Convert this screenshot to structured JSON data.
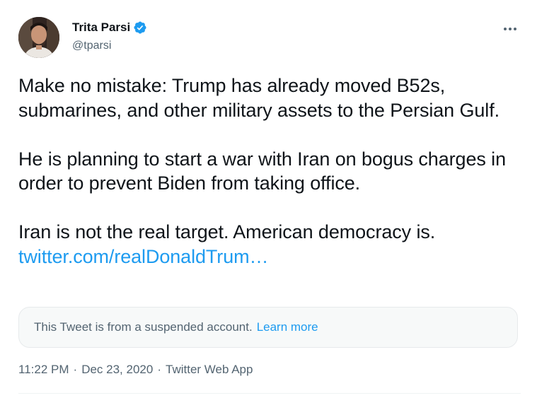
{
  "author": {
    "display_name": "Trita Parsi",
    "handle": "@tparsi",
    "verified": true,
    "avatar_icon": "profile-photo"
  },
  "more_icon": "more-horizontal-icon",
  "tweet": {
    "paragraphs": [
      "Make no mistake: Trump has already moved B52s, submarines, and other military assets to the Persian Gulf.",
      "He is planning to start a war with Iran on bogus charges in order to prevent Biden from taking office.",
      "Iran is not the real target. American democracy is."
    ],
    "link_text": "twitter.com/realDonaldTrum…"
  },
  "quoted_notice": {
    "text": "This Tweet is from a suspended account.",
    "learn_more": "Learn more"
  },
  "meta": {
    "time": "11:22 PM",
    "separator": "·",
    "date": "Dec 23, 2020",
    "source": "Twitter Web App"
  },
  "colors": {
    "link": "#1d9bf0",
    "text": "#0f1419",
    "secondary": "#536471",
    "verified_badge": "#1d9bf0"
  }
}
